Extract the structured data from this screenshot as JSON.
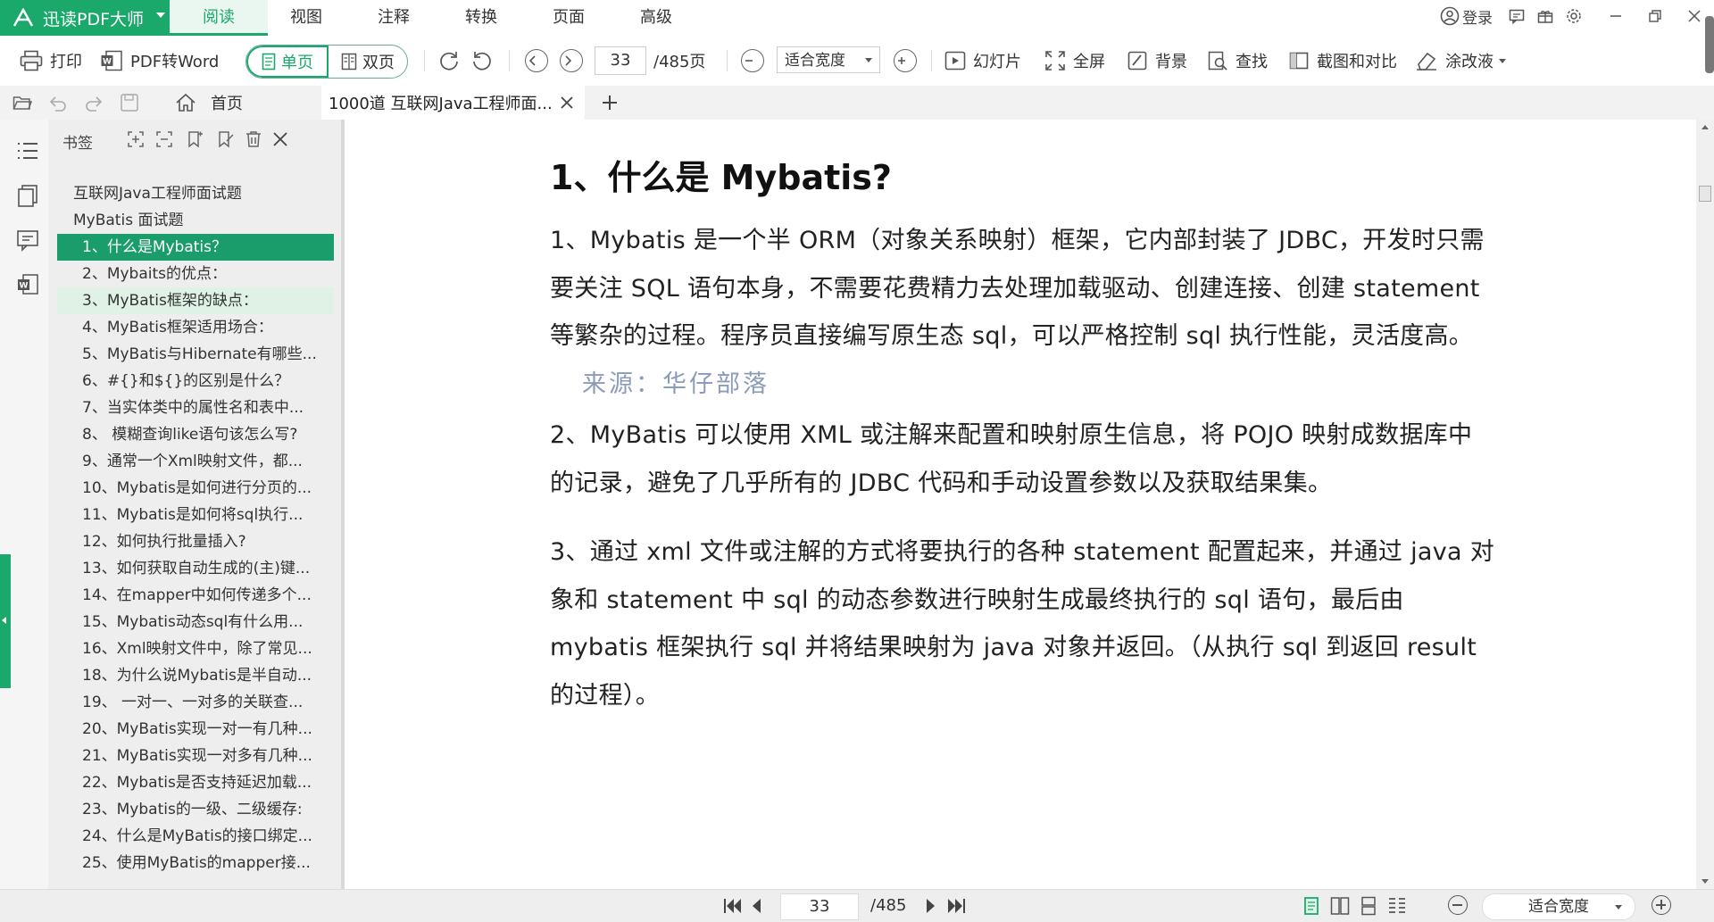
{
  "app": {
    "name": "迅读PDF大师",
    "menu_tabs": [
      {
        "label": "阅读",
        "active": true
      },
      {
        "label": "视图",
        "active": false
      },
      {
        "label": "注释",
        "active": false
      },
      {
        "label": "转换",
        "active": false
      },
      {
        "label": "页面",
        "active": false
      },
      {
        "label": "高级",
        "active": false
      }
    ],
    "login_label": "登录"
  },
  "toolbar": {
    "print": "打印",
    "pdf_to_word": "PDF转Word",
    "single_page": "单页",
    "double_page": "双页",
    "current_page": "33",
    "total_pages": "/485页",
    "zoom": "适合宽度",
    "slideshow": "幻灯片",
    "fullscreen": "全屏",
    "background": "背景",
    "find": "查找",
    "screenshot_compare": "截图和对比",
    "correction_fluid": "涂改液"
  },
  "tabs": {
    "home": "首页",
    "document": "1000道 互联网Java工程师面..."
  },
  "bookmarks": {
    "title": "书签",
    "items": [
      {
        "label": "互联网Java工程师面试题",
        "level": 0,
        "state": ""
      },
      {
        "label": "MyBatis 面试题",
        "level": 0,
        "state": ""
      },
      {
        "label": "1、什么是Mybatis？",
        "level": 1,
        "state": "selected"
      },
      {
        "label": "2、Mybaits的优点：",
        "level": 1,
        "state": ""
      },
      {
        "label": "3、MyBatis框架的缺点：",
        "level": 1,
        "state": "hover"
      },
      {
        "label": "4、MyBatis框架适用场合：",
        "level": 1,
        "state": ""
      },
      {
        "label": "5、MyBatis与Hibernate有哪些...",
        "level": 1,
        "state": ""
      },
      {
        "label": "6、#{}和${}的区别是什么？",
        "level": 1,
        "state": ""
      },
      {
        "label": "7、当实体类中的属性名和表中...",
        "level": 1,
        "state": ""
      },
      {
        "label": "8、 模糊查询like语句该怎么写?",
        "level": 1,
        "state": ""
      },
      {
        "label": "9、通常一个Xml映射文件，都...",
        "level": 1,
        "state": ""
      },
      {
        "label": "10、Mybatis是如何进行分页的...",
        "level": 1,
        "state": ""
      },
      {
        "label": "11、Mybatis是如何将sql执行...",
        "level": 1,
        "state": ""
      },
      {
        "label": "12、如何执行批量插入?",
        "level": 1,
        "state": ""
      },
      {
        "label": "13、如何获取自动生成的(主)键...",
        "level": 1,
        "state": ""
      },
      {
        "label": "14、在mapper中如何传递多个...",
        "level": 1,
        "state": ""
      },
      {
        "label": "15、Mybatis动态sql有什么用...",
        "level": 1,
        "state": ""
      },
      {
        "label": "16、Xml映射文件中，除了常见...",
        "level": 1,
        "state": ""
      },
      {
        "label": "18、为什么说Mybatis是半自动...",
        "level": 1,
        "state": ""
      },
      {
        "label": "19、 一对一、一对多的关联查...",
        "level": 1,
        "state": ""
      },
      {
        "label": "20、MyBatis实现一对一有几种...",
        "level": 1,
        "state": ""
      },
      {
        "label": "21、MyBatis实现一对多有几种...",
        "level": 1,
        "state": ""
      },
      {
        "label": "22、Mybatis是否支持延迟加载...",
        "level": 1,
        "state": ""
      },
      {
        "label": "23、Mybatis的一级、二级缓存:",
        "level": 1,
        "state": ""
      },
      {
        "label": "24、什么是MyBatis的接口绑定...",
        "level": 1,
        "state": ""
      },
      {
        "label": "25、使用MyBatis的mapper接...",
        "level": 1,
        "state": ""
      }
    ]
  },
  "document": {
    "heading": "1、什么是 Mybatis?",
    "para1": "1、Mybatis 是一个半 ORM（对象关系映射）框架，它内部封装了 JDBC，开发时只需要关注 SQL 语句本身，不需要花费精力去处理加载驱动、创建连接、创建 statement 等繁杂的过程。程序员直接编写原生态 sql，可以严格控制 sql 执行性能，灵活度高。",
    "source_note": "来源：华仔部落",
    "para2": "2、MyBatis 可以使用 XML 或注解来配置和映射原生信息，将 POJO 映射成数据库中的记录，避免了几乎所有的 JDBC 代码和手动设置参数以及获取结果集。",
    "para3": "3、通过 xml 文件或注解的方式将要执行的各种 statement 配置起来，并通过 java 对象和 statement 中 sql 的动态参数进行映射生成最终执行的 sql 语句，最后由 mybatis 框架执行 sql 并将结果映射为 java 对象并返回。（从执行 sql 到返回 result 的过程）。"
  },
  "statusbar": {
    "current_page": "33",
    "total_pages": "/485",
    "zoom": "适合宽度"
  },
  "colors": {
    "accent": "#1aa96b",
    "selected_row": "#1b9c6b",
    "source_note": "#8b9bb8"
  }
}
